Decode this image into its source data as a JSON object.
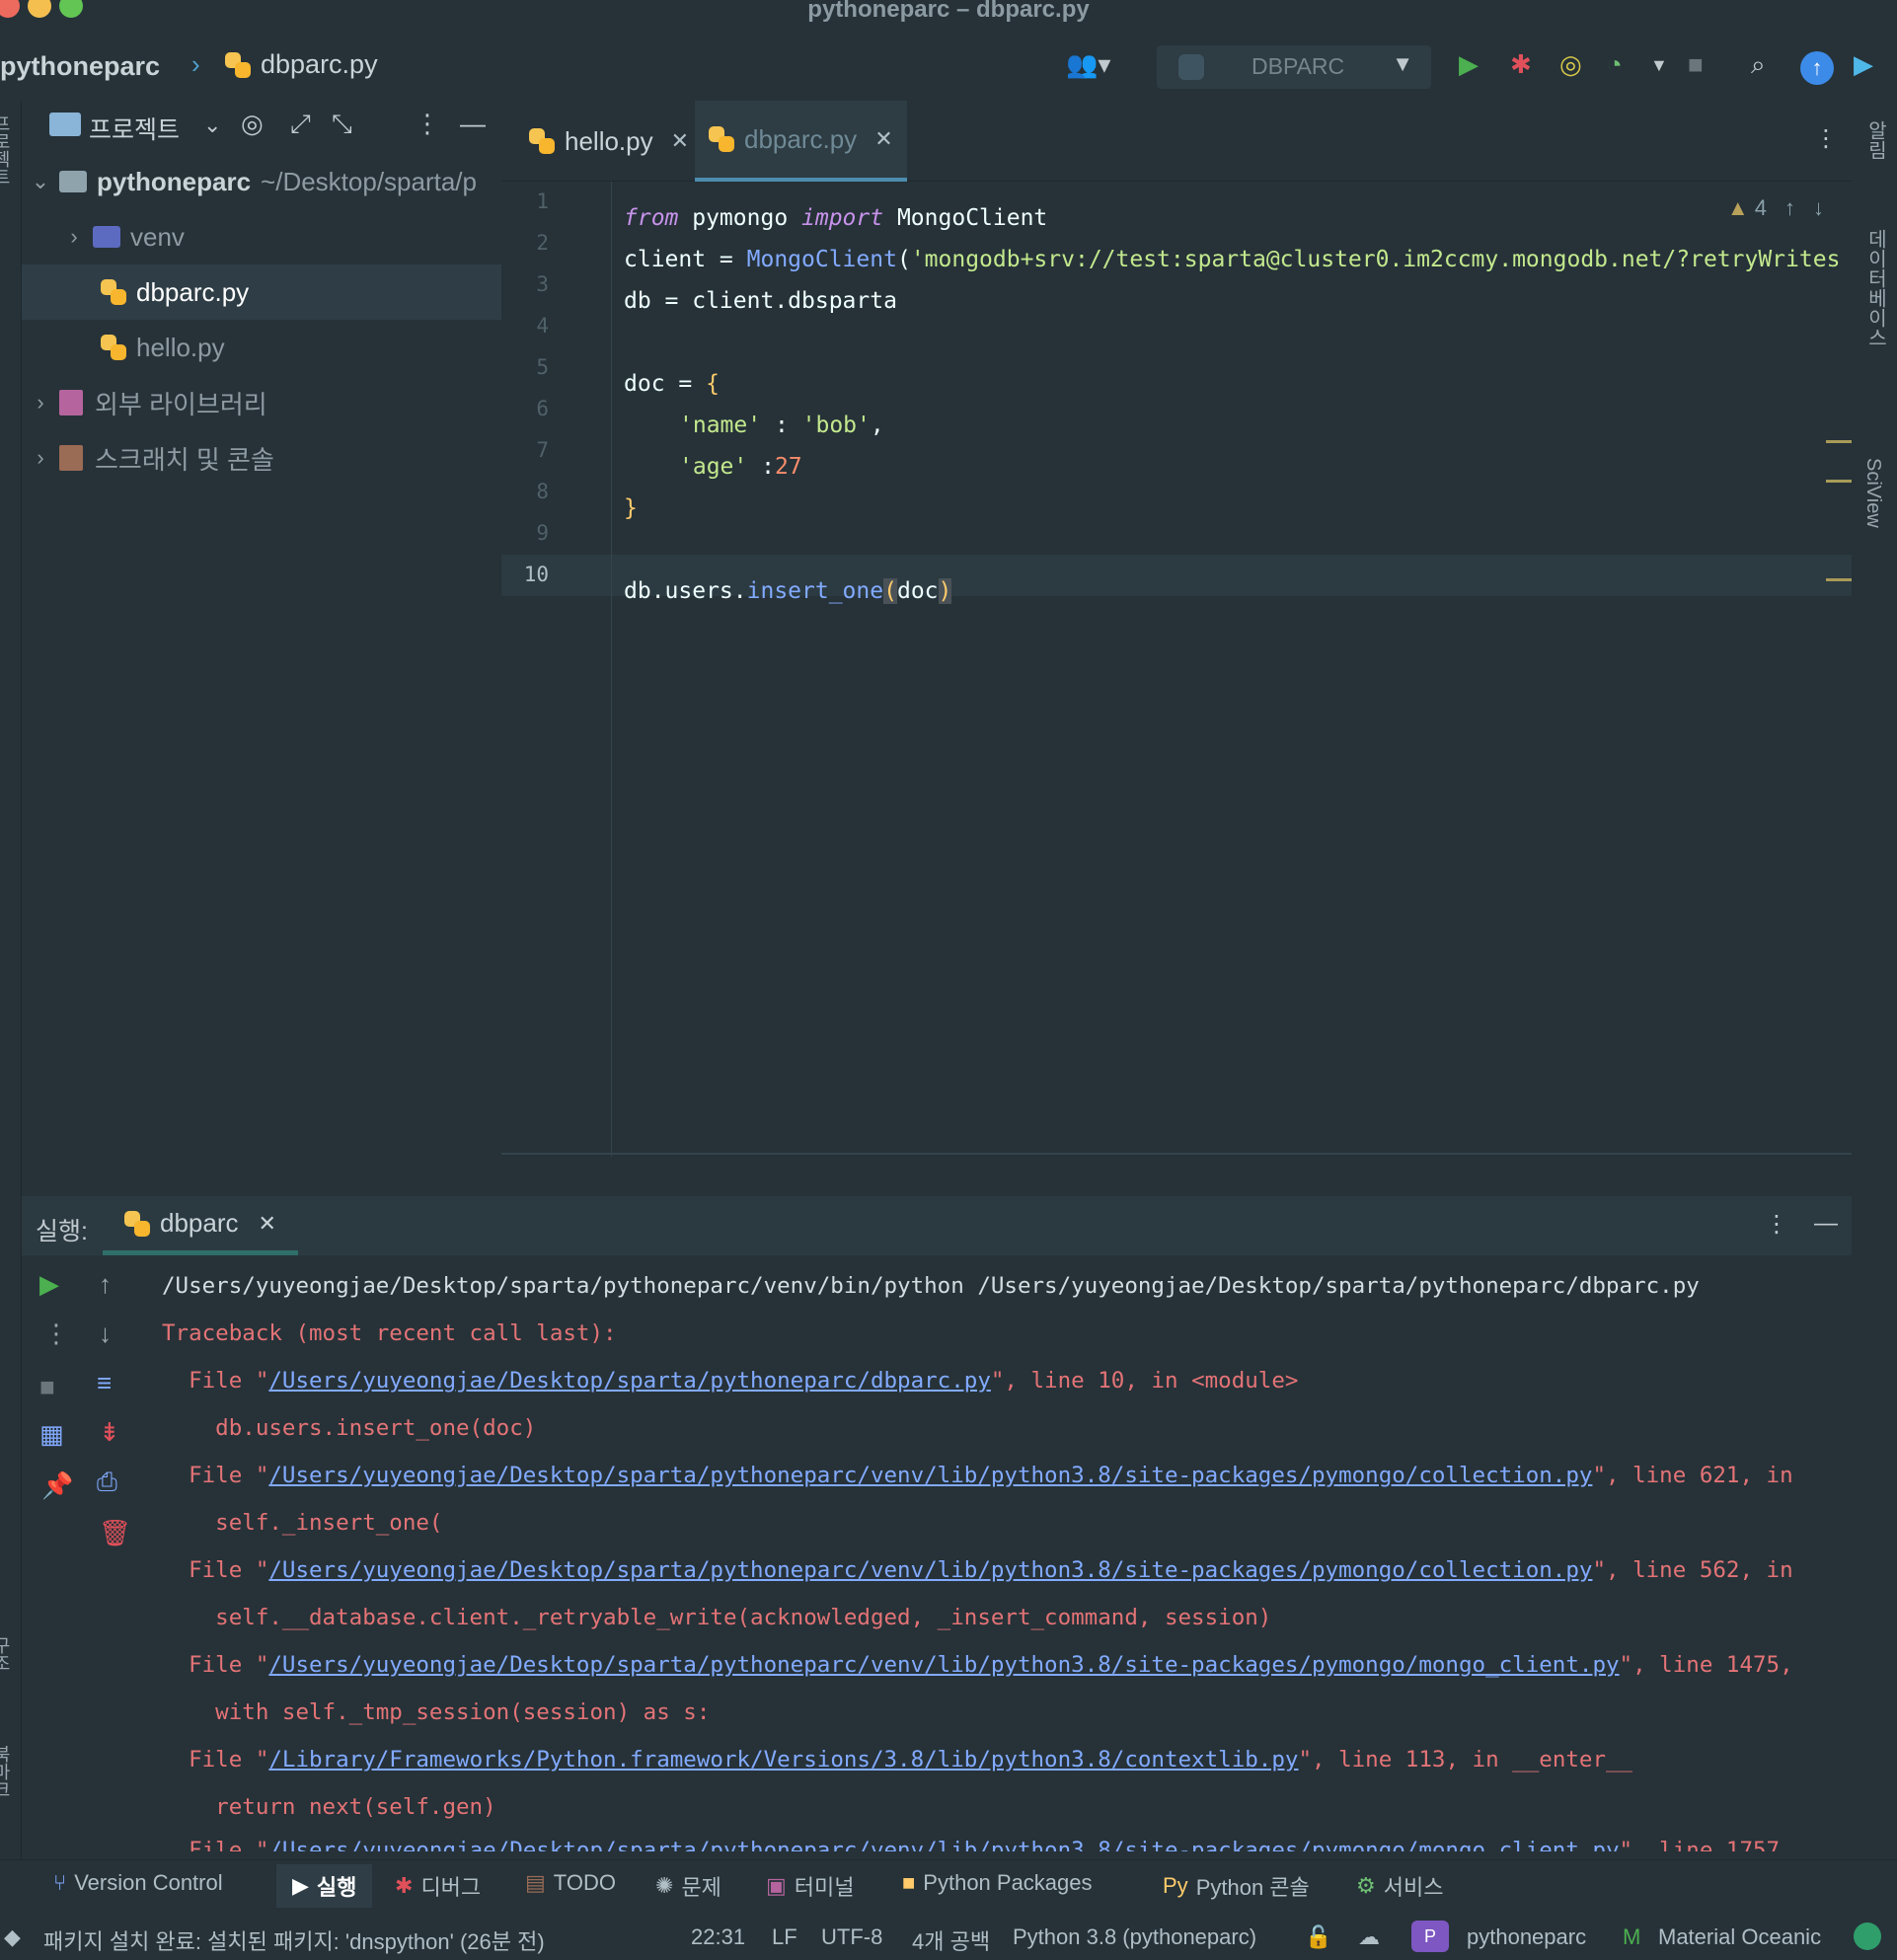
{
  "window": {
    "title": "pythoneparc – dbparc.py"
  },
  "navbar": {
    "project": "pythoneparc",
    "separator": "›",
    "file": "dbparc.py",
    "run_config": "DBPARC"
  },
  "left_strip": {
    "top_tab": "프로젝트",
    "bottom_tab_1": "구조",
    "bottom_tab_2": "북마크"
  },
  "project_panel": {
    "title": "프로젝트",
    "tree": [
      {
        "label": "pythoneparc",
        "path": "~/Desktop/sparta/p",
        "kind": "folder-root"
      },
      {
        "label": "venv",
        "kind": "folder"
      },
      {
        "label": "dbparc.py",
        "kind": "python",
        "selected": true
      },
      {
        "label": "hello.py",
        "kind": "python"
      },
      {
        "label": "외부 라이브러리",
        "kind": "library"
      },
      {
        "label": "스크래치 및 콘솔",
        "kind": "scratch"
      }
    ]
  },
  "editor": {
    "tabs": [
      {
        "label": "hello.py",
        "active": false
      },
      {
        "label": "dbparc.py",
        "active": true
      }
    ],
    "inspection_count": "4",
    "line_numbers": [
      "1",
      "2",
      "3",
      "4",
      "5",
      "6",
      "7",
      "8",
      "9",
      "10"
    ],
    "current_line": "10",
    "code": {
      "l1": {
        "kw1": "from",
        "mod": " pymongo ",
        "kw2": "import",
        "name": " MongoClient"
      },
      "l2": {
        "a": "client = ",
        "fn": "MongoClient",
        "b": "(",
        "str": "'mongodb+srv://test:sparta@cluster0.im2ccmy.mongodb.net/?retryWrites"
      },
      "l3": "db = client.dbsparta",
      "l5": {
        "a": "doc = ",
        "brace": "{"
      },
      "l6": {
        "key": "'name'",
        "mid": " : ",
        "val": "'bob'",
        "end": ","
      },
      "l7": {
        "key": "'age'",
        "mid": " :",
        "num": "27"
      },
      "l8": "}",
      "l10": {
        "a": "db.users.",
        "fn": "insert_one",
        "open": "(",
        "arg": "doc",
        "close": ")"
      }
    }
  },
  "right_strip": {
    "tab_1": "알림",
    "tab_2": "데이터베이스",
    "tab_3": "SciView"
  },
  "run_panel": {
    "label": "실행:",
    "tab": "dbparc",
    "output": {
      "cmd": "/Users/yuyeongjae/Desktop/sparta/pythoneparc/venv/bin/python /Users/yuyeongjae/Desktop/sparta/pythoneparc/dbparc.py",
      "tb": "Traceback (most recent call last):",
      "f1_pre": "  File \"",
      "f1_link": "/Users/yuyeongjae/Desktop/sparta/pythoneparc/dbparc.py",
      "f1_post": "\", line 10, in <module>",
      "c1": "    db.users.insert_one(doc)",
      "f2_pre": "  File \"",
      "f2_link": "/Users/yuyeongjae/Desktop/sparta/pythoneparc/venv/lib/python3.8/site-packages/pymongo/collection.py",
      "f2_post": "\", line 621, in",
      "c2": "    self._insert_one(",
      "f3_pre": "  File \"",
      "f3_link": "/Users/yuyeongjae/Desktop/sparta/pythoneparc/venv/lib/python3.8/site-packages/pymongo/collection.py",
      "f3_post": "\", line 562, in",
      "c3": "    self.__database.client._retryable_write(acknowledged, _insert_command, session)",
      "f4_pre": "  File \"",
      "f4_link": "/Users/yuyeongjae/Desktop/sparta/pythoneparc/venv/lib/python3.8/site-packages/pymongo/mongo_client.py",
      "f4_post": "\", line 1475,",
      "c4": "    with self._tmp_session(session) as s:",
      "f5_pre": "  File \"",
      "f5_link": "/Library/Frameworks/Python.framework/Versions/3.8/lib/python3.8/contextlib.py",
      "f5_post": "\", line 113, in __enter__",
      "c5": "    return next(self.gen)",
      "f6_pre": "  File \"",
      "f6_link": "/Users/yuyeongjae/Desktop/sparta/pythoneparc/venv/lib/python3.8/site-packages/pymongo/mongo_client.py",
      "f6_post": "\", line 1757,"
    }
  },
  "bottom_tabs": {
    "vcs": "Version Control",
    "run": "실행",
    "debug": "디버그",
    "todo": "TODO",
    "problems": "문제",
    "terminal": "터미널",
    "packages": "Python Packages",
    "console": "Python 콘솔",
    "services": "서비스"
  },
  "statusbar": {
    "message": "패키지 설치 완료: 설치된 패키지: 'dnspython' (26분 전)",
    "position": "22:31",
    "line_sep": "LF",
    "encoding": "UTF-8",
    "indent": "4개 공백",
    "interpreter": "Python 3.8 (pythoneparc)",
    "project_badge": "P",
    "project": "pythoneparc",
    "theme": "Material Oceanic"
  },
  "colors": {
    "background": "#263238",
    "error_text": "#e37376",
    "link": "#82aaff",
    "string": "#c3e88d",
    "keyword": "#c792ea",
    "run_green": "#4caf50"
  }
}
